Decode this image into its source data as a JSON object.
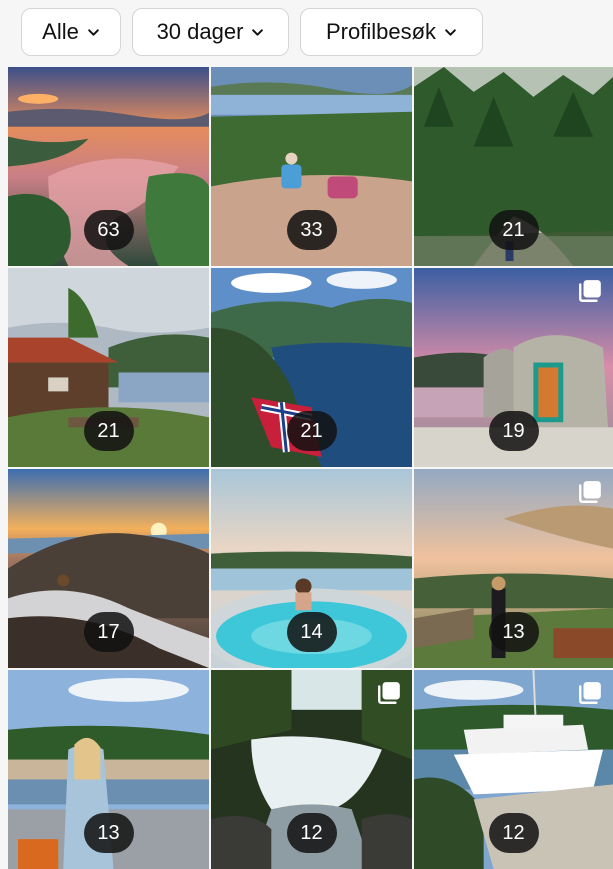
{
  "filters": [
    {
      "label": "Alle",
      "icon": "chevron-down-icon"
    },
    {
      "label": "30 dager",
      "icon": "chevron-down-icon"
    },
    {
      "label": "Profilbesøk",
      "icon": "chevron-down-icon"
    }
  ],
  "posts": [
    {
      "count": "63",
      "multi": false,
      "scene": "sunset-lake-aerial"
    },
    {
      "count": "33",
      "multi": false,
      "scene": "family-hiking-rock"
    },
    {
      "count": "21",
      "multi": false,
      "scene": "forest-path"
    },
    {
      "count": "21",
      "multi": false,
      "scene": "cabin-picnic-table"
    },
    {
      "count": "21",
      "multi": false,
      "scene": "fjord-norwegian-flag"
    },
    {
      "count": "19",
      "multi": true,
      "scene": "yurt-by-lake"
    },
    {
      "count": "17",
      "multi": false,
      "scene": "mountain-sunrise"
    },
    {
      "count": "14",
      "multi": false,
      "scene": "hot-tub-archipelago"
    },
    {
      "count": "13",
      "multi": true,
      "scene": "terrace-parasol"
    },
    {
      "count": "13",
      "multi": false,
      "scene": "woman-harbour-view"
    },
    {
      "count": "12",
      "multi": true,
      "scene": "waterfall-forest"
    },
    {
      "count": "12",
      "multi": true,
      "scene": "passenger-boat"
    }
  ],
  "colors": {
    "badge": "#111111",
    "chip_border": "#d5d5d5",
    "background": "#f6f6f6"
  }
}
